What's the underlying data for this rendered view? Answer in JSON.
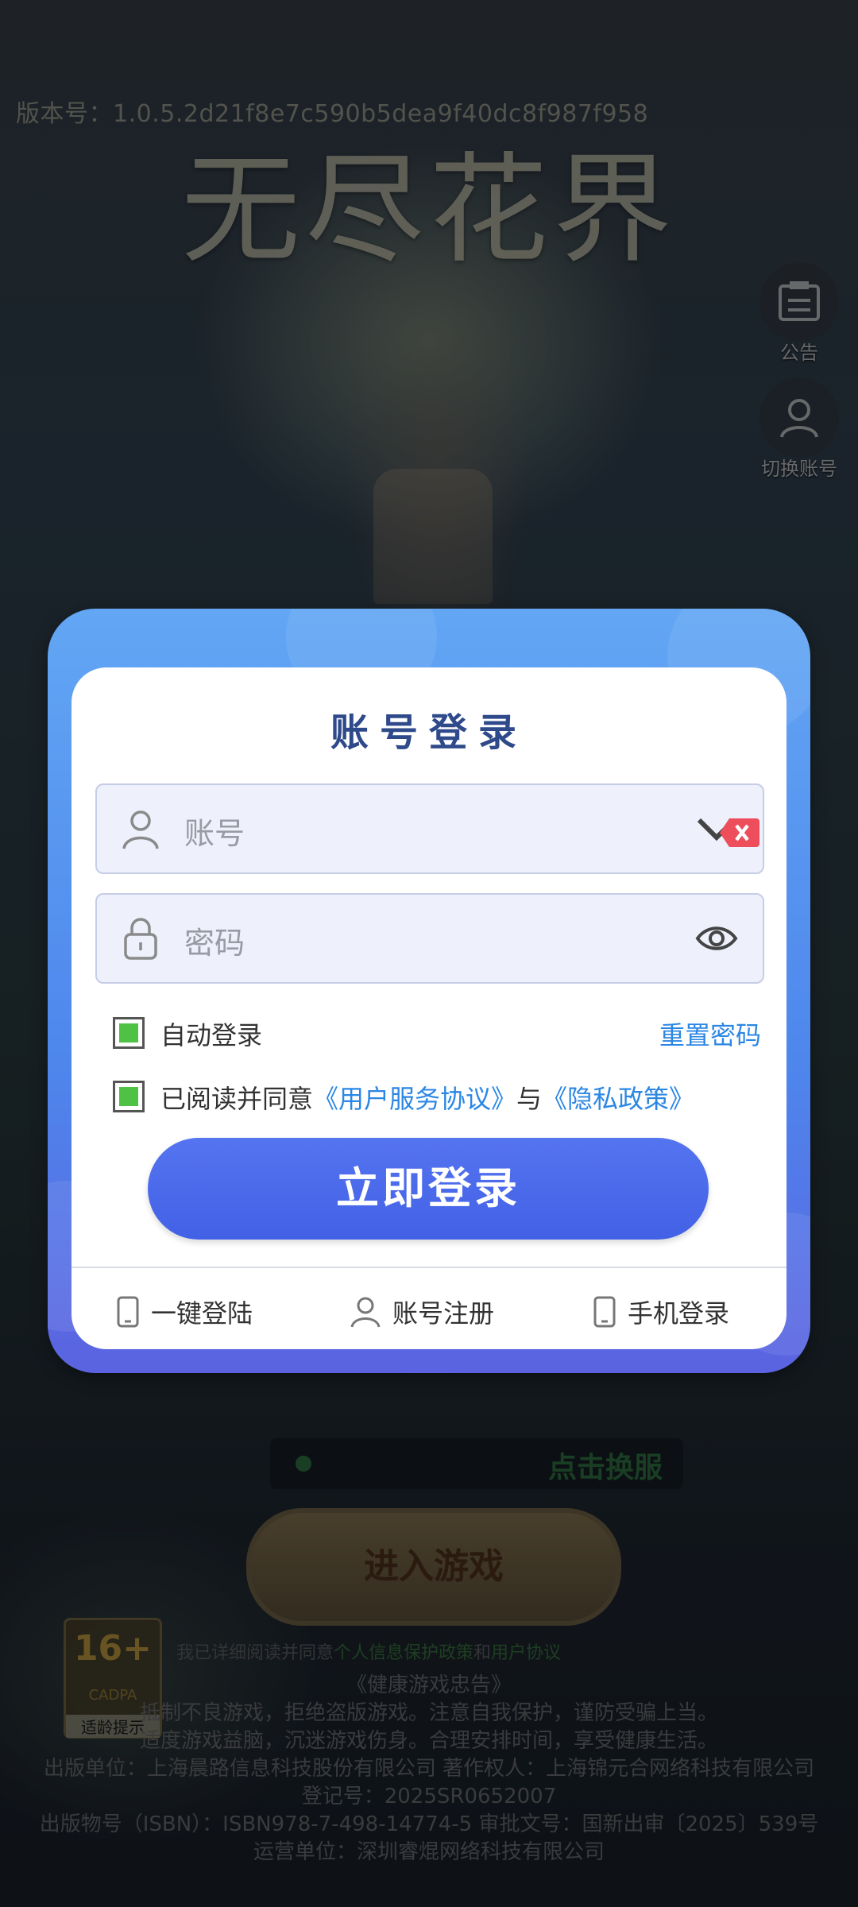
{
  "version_text": "版本号：1.0.5.2d21f8e7c590b5dea9f40dc8f987f958",
  "logo_text": "无尽花界",
  "side": {
    "notice_label": "公告",
    "switch_label": "切换账号"
  },
  "background": {
    "server_text": "点击换服",
    "enter_label": "进入游戏",
    "age_num": "16+",
    "age_cadpa": "CADPA",
    "age_tip": "适龄提示",
    "agree_prefix": "我已详细阅读并同意",
    "agree_privacy": "个人信息保护政策",
    "agree_and": "和",
    "agree_user": "用户协议",
    "footer_lines": [
      "《健康游戏忠告》",
      "抵制不良游戏，拒绝盗版游戏。注意自我保护，谨防受骗上当。",
      "适度游戏益脑，沉迷游戏伤身。合理安排时间，享受健康生活。",
      "出版单位：上海晨路信息科技股份有限公司  著作权人：上海锦元合网络科技有限公司",
      "登记号：2025SR0652007",
      "出版物号（ISBN）：ISBN978-7-498-14774-5 审批文号：国新出审〔2025〕539号",
      "运营单位：深圳睿焜网络科技有限公司"
    ]
  },
  "login": {
    "title": "账号登录",
    "account_placeholder": "账号",
    "password_placeholder": "密码",
    "auto_login_label": "自动登录",
    "reset_password": "重置密码",
    "agree_prefix": "已阅读并同意",
    "agree_service": "《用户服务协议》",
    "agree_and": "与",
    "agree_privacy": "《隐私政策》",
    "login_button": "立即登录",
    "one_click": "一键登陆",
    "register": "账号注册",
    "phone_login": "手机登录",
    "auto_login_checked": true,
    "agree_checked": true
  },
  "colors": {
    "accent": "#4261e6",
    "link": "#2b87e4",
    "check": "#4fc246"
  }
}
